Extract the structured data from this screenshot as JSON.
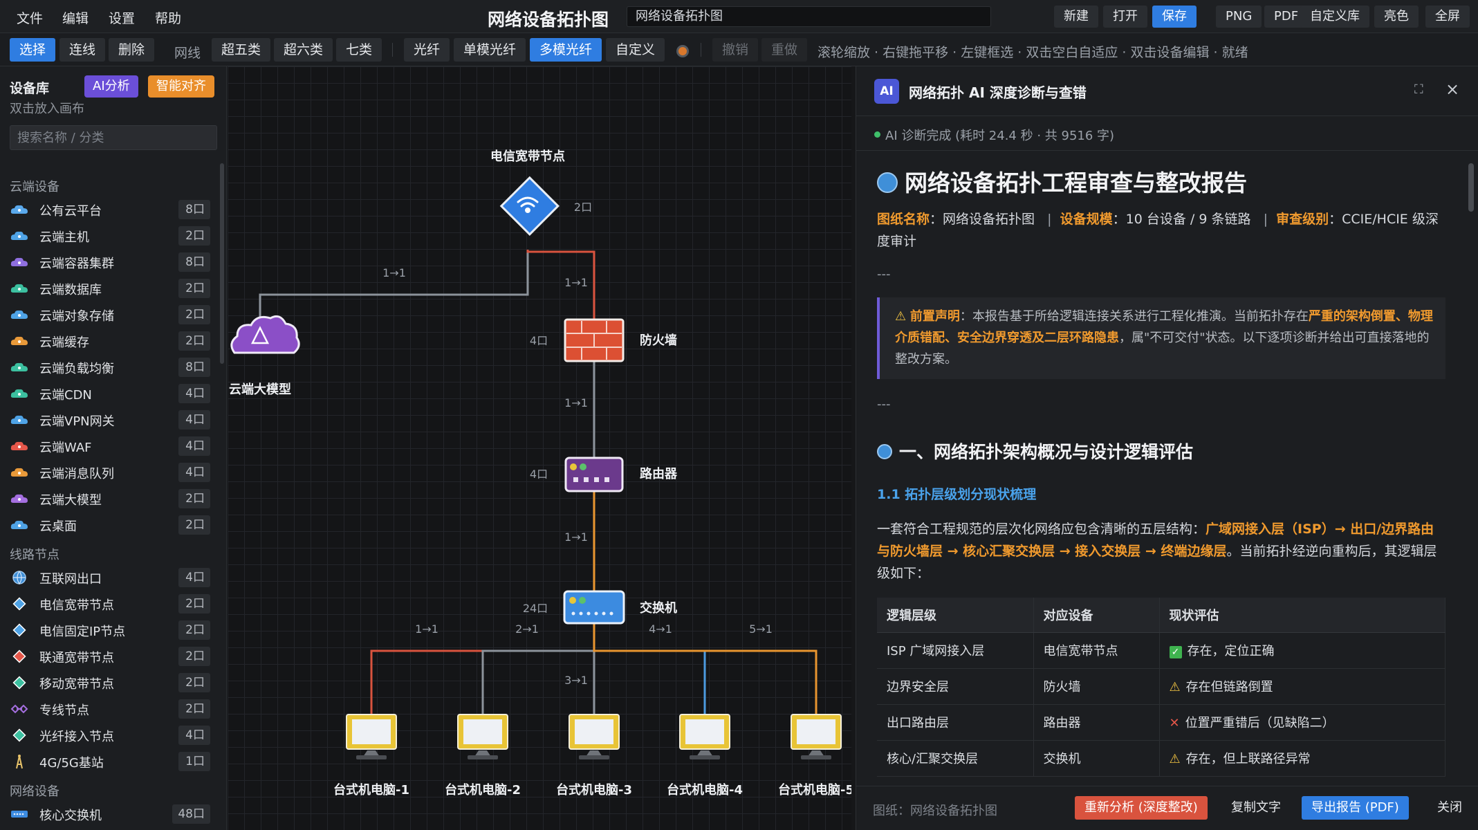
{
  "menu": [
    "文件",
    "编辑",
    "设置",
    "帮助"
  ],
  "app_title": "网络设备拓扑图",
  "doc_name": "网络设备拓扑图",
  "top_buttons": [
    "新建",
    "打开",
    "保存",
    "PNG",
    "PDF",
    "自定义库",
    "亮色",
    "全屏"
  ],
  "toolbar": {
    "select": "选择",
    "connect": "连线",
    "delete": "删除",
    "cable_label": "网线",
    "cat5e": "超五类",
    "cat6": "超六类",
    "cat7": "七类",
    "fiber": "光纤",
    "single_mode": "单模光纤",
    "multi_mode": "多模光纤",
    "custom": "自定义",
    "undo": "撤销",
    "redo": "重做",
    "hint": "滚轮缩放 · 右键拖平移 · 左键框选 · 双击空白自适应 · 双击设备编辑 · 就绪"
  },
  "sidebar": {
    "title": "设备库",
    "ai_analyze": "AI分析",
    "smart_align": "智能对齐",
    "subtitle": "双击放入画布",
    "search_placeholder": "搜索名称 / 分类",
    "categories": [
      {
        "title": "云端设备",
        "items": [
          {
            "name": "公有云平台",
            "ports": "8口",
            "icon": "cloud-icon"
          },
          {
            "name": "云端主机",
            "ports": "2口",
            "icon": "cloud-icon"
          },
          {
            "name": "云端容器集群",
            "ports": "8口",
            "icon": "cloud-icon"
          },
          {
            "name": "云端数据库",
            "ports": "2口",
            "icon": "cloud-icon"
          },
          {
            "name": "云端对象存储",
            "ports": "2口",
            "icon": "cloud-icon"
          },
          {
            "name": "云端缓存",
            "ports": "2口",
            "icon": "cloud-icon"
          },
          {
            "name": "云端负载均衡",
            "ports": "8口",
            "icon": "cloud-icon"
          },
          {
            "name": "云端CDN",
            "ports": "4口",
            "icon": "cloud-icon"
          },
          {
            "name": "云端VPN网关",
            "ports": "4口",
            "icon": "cloud-icon"
          },
          {
            "name": "云端WAF",
            "ports": "4口",
            "icon": "cloud-icon"
          },
          {
            "name": "云端消息队列",
            "ports": "4口",
            "icon": "cloud-icon"
          },
          {
            "name": "云端大模型",
            "ports": "2口",
            "icon": "cloud-icon"
          },
          {
            "name": "云桌面",
            "ports": "2口",
            "icon": "cloud-icon"
          }
        ]
      },
      {
        "title": "线路节点",
        "items": [
          {
            "name": "互联网出口",
            "ports": "4口",
            "icon": "globe-icon"
          },
          {
            "name": "电信宽带节点",
            "ports": "2口",
            "icon": "diamond-icon"
          },
          {
            "name": "电信固定IP节点",
            "ports": "2口",
            "icon": "diamond-icon"
          },
          {
            "name": "联通宽带节点",
            "ports": "2口",
            "icon": "diamond-icon"
          },
          {
            "name": "移动宽带节点",
            "ports": "2口",
            "icon": "diamond-icon"
          },
          {
            "name": "专线节点",
            "ports": "2口",
            "icon": "link-icon"
          },
          {
            "name": "光纤接入节点",
            "ports": "4口",
            "icon": "diamond-icon"
          },
          {
            "name": "4G/5G基站",
            "ports": "1口",
            "icon": "tower-icon"
          }
        ]
      },
      {
        "title": "网络设备",
        "items": [
          {
            "name": "核心交换机",
            "ports": "48口",
            "icon": "switch-icon"
          }
        ]
      }
    ]
  },
  "canvas": {
    "nodes": {
      "isp": {
        "label": "电信宽带节点",
        "ports": "2口"
      },
      "cloud": {
        "label": "云端大模型"
      },
      "firewall": {
        "label": "防火墙",
        "ports": "4口"
      },
      "router": {
        "label": "路由器",
        "ports": "4口"
      },
      "switch": {
        "label": "交换机",
        "ports": "24口"
      },
      "pcs": [
        "台式机电脑-1",
        "台式机电脑-2",
        "台式机电脑-3",
        "台式机电脑-4",
        "台式机电脑-5"
      ]
    },
    "links": {
      "isp_cloud": "1→1",
      "isp_fw": "1→1",
      "fw_router": "1→1",
      "router_switch": "1→1",
      "sw_pc1": "1→1",
      "sw_pc2": "2→1",
      "sw_pc3": "3→1",
      "sw_pc4": "4→1",
      "sw_pc5": "5→1"
    }
  },
  "ai": {
    "badge": "AI",
    "title": "网络拓扑 AI 深度诊断与查错",
    "status": "AI 诊断完成 (耗时 24.4 秒 · 共 9516 字)",
    "report_title": "网络设备拓扑工程审查与整改报告",
    "meta": {
      "k1": "图纸名称",
      "v1": "：网络设备拓扑图",
      "k2": "设备规模",
      "v2": "：10 台设备 / 9 条链路",
      "k3": "审查级别",
      "v3": "：CCIE/HCIE 级深度审计"
    },
    "hr": "---",
    "notice": {
      "title": "前置声明",
      "text_a": "：本报告基于所给逻辑连接关系进行工程化推演。当前拓扑存在",
      "highlight": "严重的架构倒置、物理介质错配、安全边界穿透及二层环路隐患",
      "text_b": "，属\"不可交付\"状态。以下逐项诊断并给出可直接落地的整改方案。"
    },
    "section1": "一、网络拓扑架构概况与设计逻辑评估",
    "sub1": "1.1 拓扑层级划分现状梳理",
    "para_a": "一套符合工程规范的层次化网络应包含清晰的五层结构：",
    "para_hl": "广域网接入层（ISP）→ 出口/边界路由与防火墙层 → 核心汇聚交换层 → 接入交换层 → 终端边缘层",
    "para_b": "。当前拓扑经逆向重构后，其逻辑层级如下：",
    "table_headers": [
      "逻辑层级",
      "对应设备",
      "现状评估"
    ],
    "table_rows": [
      [
        "ISP 广域网接入层",
        "电信宽带节点",
        "存在，定位正确",
        "ok"
      ],
      [
        "边界安全层",
        "防火墙",
        "存在但链路倒置",
        "warn"
      ],
      [
        "出口路由层",
        "路由器",
        "位置严重错后（见缺陷二）",
        "err"
      ],
      [
        "核心/汇聚交换层",
        "交换机",
        "存在，但上联路径异常",
        "warn"
      ]
    ],
    "footer_doc": "图纸：网络设备拓扑图",
    "reanalyze": "重新分析 (深度整改)",
    "copy": "复制文字",
    "export": "导出报告 (PDF)",
    "close": "关闭"
  }
}
